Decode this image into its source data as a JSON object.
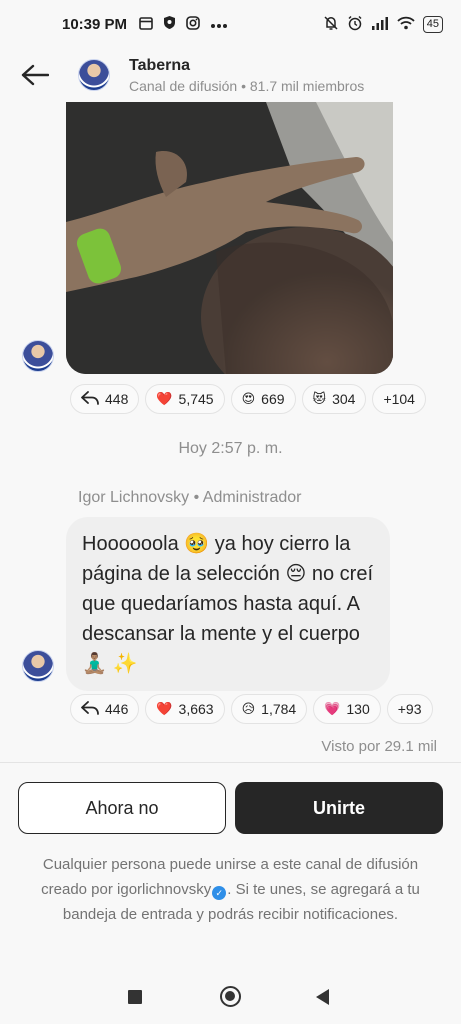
{
  "status_bar": {
    "time": "10:39 PM",
    "battery": "45"
  },
  "header": {
    "channel_name": "Taberna",
    "channel_subtitle": "Canal de difusión • 81.7 mil miembros"
  },
  "photo_reactions": [
    {
      "emoji": "↩",
      "count": "448",
      "icon": "reply-icon"
    },
    {
      "emoji": "❤️",
      "count": "5,745",
      "icon": "heart-icon"
    },
    {
      "emoji": "😍",
      "count": "669",
      "icon": "heart-eyes-icon"
    },
    {
      "emoji": "😻",
      "count": "304",
      "icon": "heart-eyes-cat-icon"
    },
    {
      "emoji": "",
      "count": "+104",
      "icon": ""
    }
  ],
  "timestamp": "Hoy 2:57 p. m.",
  "message": {
    "sender": "Igor Lichnovsky • Administrador",
    "text": "Hoooooola 🥹 ya hoy cierro la página de la selección 😔 no creí que quedaríamos hasta aquí. A descansar la mente y el cuerpo 🧘🏽‍♂️ ✨"
  },
  "message_reactions": [
    {
      "emoji": "↩",
      "count": "446",
      "icon": "reply-icon"
    },
    {
      "emoji": "❤️",
      "count": "3,663",
      "icon": "heart-icon"
    },
    {
      "emoji": "😥",
      "count": "1,784",
      "icon": "sad-relieved-icon"
    },
    {
      "emoji": "💗",
      "count": "130",
      "icon": "growing-heart-icon"
    },
    {
      "emoji": "",
      "count": "+93",
      "icon": ""
    }
  ],
  "seen_by": "Visto por 29.1 mil",
  "buttons": {
    "not_now": "Ahora no",
    "join": "Unirte"
  },
  "disclaimer": {
    "before": "Cualquier persona puede unirse a este canal de difusión creado por igorlichnovsky",
    "after": ". Si te unes, se agregará a tu bandeja de entrada y podrás recibir notificaciones."
  },
  "colors": {
    "background": "#f8f8f8",
    "bubble": "#efefef",
    "primary_button": "#262626",
    "muted_text": "#8e8e8e",
    "verified": "#2f8fe8"
  }
}
